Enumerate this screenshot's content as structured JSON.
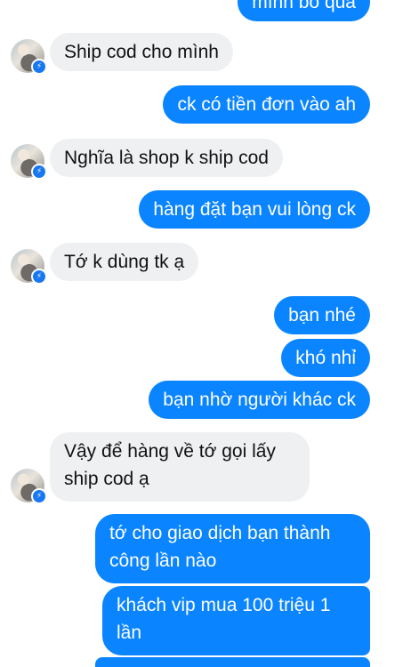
{
  "messages": [
    {
      "from": "me",
      "text": "mình bỏ qua"
    },
    {
      "from": "them",
      "text": "Ship cod cho mình"
    },
    {
      "from": "me",
      "text": "ck có tiền đơn vào ah"
    },
    {
      "from": "them",
      "text": "Nghĩa là shop k ship cod"
    },
    {
      "from": "me",
      "text": "hàng đặt bạn vui lòng ck"
    },
    {
      "from": "them",
      "text": "Tớ k dùng tk ạ"
    },
    {
      "from": "me",
      "text": "bạn nhé"
    },
    {
      "from": "me",
      "text": "khó nhỉ"
    },
    {
      "from": "me",
      "text": "bạn nhờ người khác ck"
    },
    {
      "from": "them",
      "text": "Vậy để hàng về tớ gọi lấy ship cod ạ"
    },
    {
      "from": "me",
      "text": "tớ cho giao dịch bạn thành công lần nào"
    },
    {
      "from": "me",
      "text": "khách vip mua 100 triệu 1 lần"
    }
  ],
  "colors": {
    "outgoing_bubble": "#0a84ff",
    "incoming_bubble": "#eff0f2",
    "messenger_badge": "#1877f2"
  },
  "icons": {
    "avatar_badge": "messenger-icon"
  }
}
